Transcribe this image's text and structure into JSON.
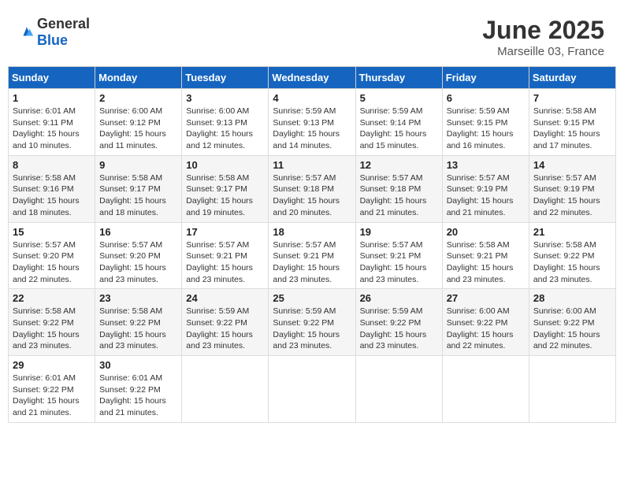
{
  "header": {
    "logo_general": "General",
    "logo_blue": "Blue",
    "month_title": "June 2025",
    "location": "Marseille 03, France"
  },
  "weekdays": [
    "Sunday",
    "Monday",
    "Tuesday",
    "Wednesday",
    "Thursday",
    "Friday",
    "Saturday"
  ],
  "weeks": [
    [
      {
        "day": "1",
        "sunrise": "Sunrise: 6:01 AM",
        "sunset": "Sunset: 9:11 PM",
        "daylight": "Daylight: 15 hours and 10 minutes."
      },
      {
        "day": "2",
        "sunrise": "Sunrise: 6:00 AM",
        "sunset": "Sunset: 9:12 PM",
        "daylight": "Daylight: 15 hours and 11 minutes."
      },
      {
        "day": "3",
        "sunrise": "Sunrise: 6:00 AM",
        "sunset": "Sunset: 9:13 PM",
        "daylight": "Daylight: 15 hours and 12 minutes."
      },
      {
        "day": "4",
        "sunrise": "Sunrise: 5:59 AM",
        "sunset": "Sunset: 9:13 PM",
        "daylight": "Daylight: 15 hours and 14 minutes."
      },
      {
        "day": "5",
        "sunrise": "Sunrise: 5:59 AM",
        "sunset": "Sunset: 9:14 PM",
        "daylight": "Daylight: 15 hours and 15 minutes."
      },
      {
        "day": "6",
        "sunrise": "Sunrise: 5:59 AM",
        "sunset": "Sunset: 9:15 PM",
        "daylight": "Daylight: 15 hours and 16 minutes."
      },
      {
        "day": "7",
        "sunrise": "Sunrise: 5:58 AM",
        "sunset": "Sunset: 9:15 PM",
        "daylight": "Daylight: 15 hours and 17 minutes."
      }
    ],
    [
      {
        "day": "8",
        "sunrise": "Sunrise: 5:58 AM",
        "sunset": "Sunset: 9:16 PM",
        "daylight": "Daylight: 15 hours and 18 minutes."
      },
      {
        "day": "9",
        "sunrise": "Sunrise: 5:58 AM",
        "sunset": "Sunset: 9:17 PM",
        "daylight": "Daylight: 15 hours and 18 minutes."
      },
      {
        "day": "10",
        "sunrise": "Sunrise: 5:58 AM",
        "sunset": "Sunset: 9:17 PM",
        "daylight": "Daylight: 15 hours and 19 minutes."
      },
      {
        "day": "11",
        "sunrise": "Sunrise: 5:57 AM",
        "sunset": "Sunset: 9:18 PM",
        "daylight": "Daylight: 15 hours and 20 minutes."
      },
      {
        "day": "12",
        "sunrise": "Sunrise: 5:57 AM",
        "sunset": "Sunset: 9:18 PM",
        "daylight": "Daylight: 15 hours and 21 minutes."
      },
      {
        "day": "13",
        "sunrise": "Sunrise: 5:57 AM",
        "sunset": "Sunset: 9:19 PM",
        "daylight": "Daylight: 15 hours and 21 minutes."
      },
      {
        "day": "14",
        "sunrise": "Sunrise: 5:57 AM",
        "sunset": "Sunset: 9:19 PM",
        "daylight": "Daylight: 15 hours and 22 minutes."
      }
    ],
    [
      {
        "day": "15",
        "sunrise": "Sunrise: 5:57 AM",
        "sunset": "Sunset: 9:20 PM",
        "daylight": "Daylight: 15 hours and 22 minutes."
      },
      {
        "day": "16",
        "sunrise": "Sunrise: 5:57 AM",
        "sunset": "Sunset: 9:20 PM",
        "daylight": "Daylight: 15 hours and 23 minutes."
      },
      {
        "day": "17",
        "sunrise": "Sunrise: 5:57 AM",
        "sunset": "Sunset: 9:21 PM",
        "daylight": "Daylight: 15 hours and 23 minutes."
      },
      {
        "day": "18",
        "sunrise": "Sunrise: 5:57 AM",
        "sunset": "Sunset: 9:21 PM",
        "daylight": "Daylight: 15 hours and 23 minutes."
      },
      {
        "day": "19",
        "sunrise": "Sunrise: 5:57 AM",
        "sunset": "Sunset: 9:21 PM",
        "daylight": "Daylight: 15 hours and 23 minutes."
      },
      {
        "day": "20",
        "sunrise": "Sunrise: 5:58 AM",
        "sunset": "Sunset: 9:21 PM",
        "daylight": "Daylight: 15 hours and 23 minutes."
      },
      {
        "day": "21",
        "sunrise": "Sunrise: 5:58 AM",
        "sunset": "Sunset: 9:22 PM",
        "daylight": "Daylight: 15 hours and 23 minutes."
      }
    ],
    [
      {
        "day": "22",
        "sunrise": "Sunrise: 5:58 AM",
        "sunset": "Sunset: 9:22 PM",
        "daylight": "Daylight: 15 hours and 23 minutes."
      },
      {
        "day": "23",
        "sunrise": "Sunrise: 5:58 AM",
        "sunset": "Sunset: 9:22 PM",
        "daylight": "Daylight: 15 hours and 23 minutes."
      },
      {
        "day": "24",
        "sunrise": "Sunrise: 5:59 AM",
        "sunset": "Sunset: 9:22 PM",
        "daylight": "Daylight: 15 hours and 23 minutes."
      },
      {
        "day": "25",
        "sunrise": "Sunrise: 5:59 AM",
        "sunset": "Sunset: 9:22 PM",
        "daylight": "Daylight: 15 hours and 23 minutes."
      },
      {
        "day": "26",
        "sunrise": "Sunrise: 5:59 AM",
        "sunset": "Sunset: 9:22 PM",
        "daylight": "Daylight: 15 hours and 23 minutes."
      },
      {
        "day": "27",
        "sunrise": "Sunrise: 6:00 AM",
        "sunset": "Sunset: 9:22 PM",
        "daylight": "Daylight: 15 hours and 22 minutes."
      },
      {
        "day": "28",
        "sunrise": "Sunrise: 6:00 AM",
        "sunset": "Sunset: 9:22 PM",
        "daylight": "Daylight: 15 hours and 22 minutes."
      }
    ],
    [
      {
        "day": "29",
        "sunrise": "Sunrise: 6:01 AM",
        "sunset": "Sunset: 9:22 PM",
        "daylight": "Daylight: 15 hours and 21 minutes."
      },
      {
        "day": "30",
        "sunrise": "Sunrise: 6:01 AM",
        "sunset": "Sunset: 9:22 PM",
        "daylight": "Daylight: 15 hours and 21 minutes."
      },
      null,
      null,
      null,
      null,
      null
    ]
  ]
}
